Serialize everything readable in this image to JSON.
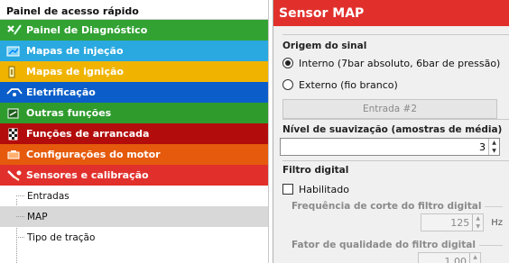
{
  "left_panel": {
    "title": "Painel de acesso rápido",
    "categories": [
      {
        "label": "Painel de Diagnóstico",
        "color": "#32a233",
        "icon": "diagnostic-icon"
      },
      {
        "label": "Mapas de injeção",
        "color": "#2aa9e0",
        "icon": "injection-map-icon"
      },
      {
        "label": "Mapas de ignição",
        "color": "#f0b400",
        "icon": "ignition-map-icon"
      },
      {
        "label": "Eletrificação",
        "color": "#0b5ec9",
        "icon": "electrical-icon"
      },
      {
        "label": "Outras funções",
        "color": "#2e9b2c",
        "icon": "other-functions-icon"
      },
      {
        "label": "Funções de arrancada",
        "color": "#b30c0c",
        "icon": "drag-race-icon"
      },
      {
        "label": "Configurações do motor",
        "color": "#e55a0c",
        "icon": "engine-icon"
      },
      {
        "label": "Sensores e calibração",
        "color": "#e1302c",
        "icon": "sensor-icon"
      }
    ],
    "subitems": [
      {
        "label": "Entradas",
        "selected": false
      },
      {
        "label": "MAP",
        "selected": true
      },
      {
        "label": "Tipo de tração",
        "selected": false
      }
    ]
  },
  "sensor_panel": {
    "title": "Sensor MAP",
    "header_color": "#e1302c",
    "signal_origin": {
      "title": "Origem do sinal",
      "option_internal": "Interno (7bar absoluto, 6bar de pressão)",
      "option_external": "Externo (fio branco)",
      "selected": "internal",
      "input_button": "Entrada #2"
    },
    "smoothing": {
      "title": "Nível de suavização (amostras de média)",
      "value": "3"
    },
    "digital_filter": {
      "title": "Filtro digital",
      "enabled_label": "Habilitado",
      "enabled": false,
      "cutoff_label": "Frequência de corte do filtro digital",
      "cutoff_value": "125",
      "cutoff_unit": "Hz",
      "quality_label": "Fator de qualidade do filtro digital",
      "quality_value": "1,00"
    }
  }
}
